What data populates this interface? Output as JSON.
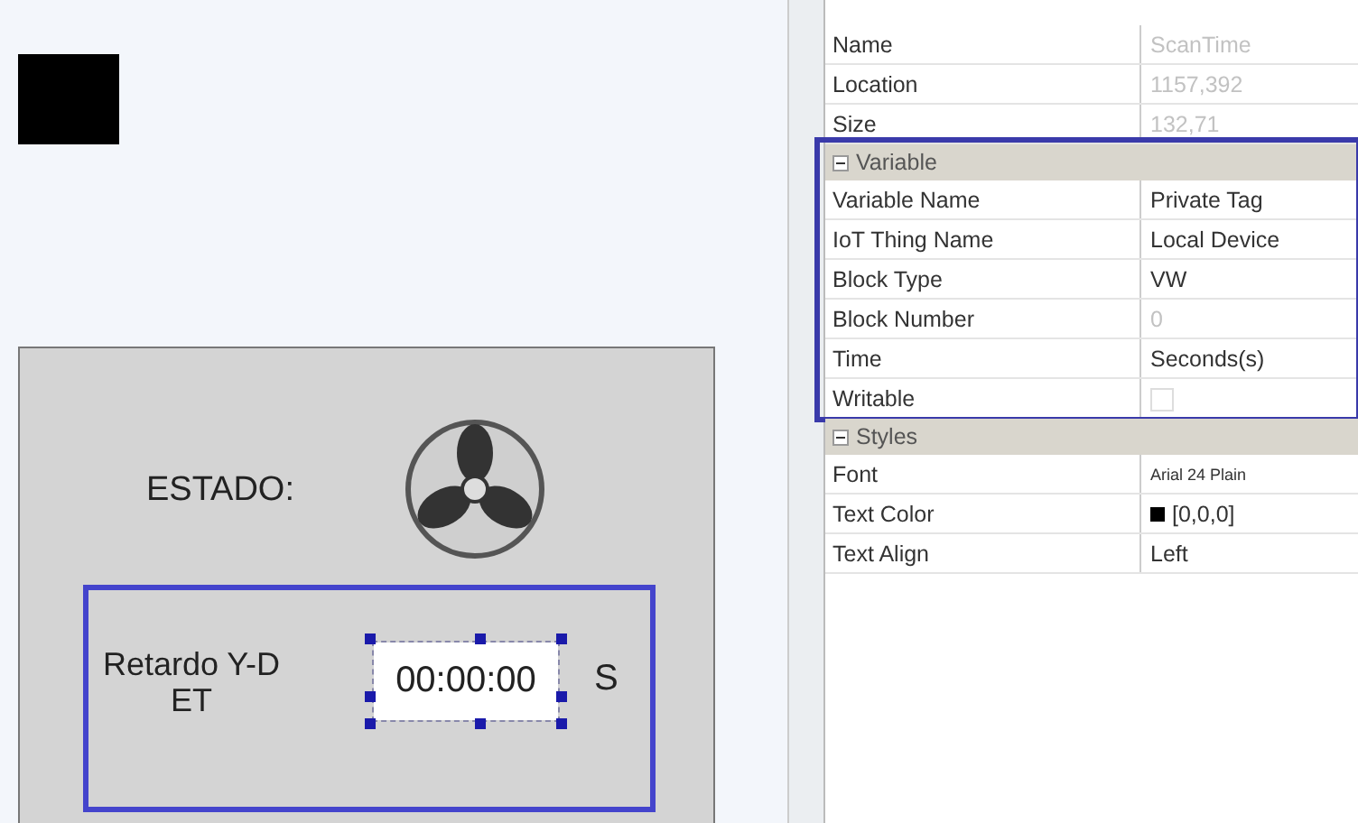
{
  "canvas": {
    "status_label": "ESTADO:",
    "delay_label": "Retardo Y-D ET",
    "time_field": {
      "value": "00:00:00",
      "selected": true
    },
    "unit": "S"
  },
  "properties": {
    "rows": [
      {
        "kind": "text",
        "label": "Name",
        "value": "ScanTime",
        "disabled": true
      },
      {
        "kind": "text",
        "label": "Location",
        "value": "1157,392",
        "disabled": true
      },
      {
        "kind": "text",
        "label": "Size",
        "value": "132,71",
        "disabled": true
      }
    ],
    "groups": [
      {
        "title": "Variable",
        "expanded": true,
        "selected": true,
        "rows": [
          {
            "kind": "text",
            "label": "Variable Name",
            "value": "Private Tag",
            "disabled": false,
            "small": false
          },
          {
            "kind": "text",
            "label": "IoT Thing Name",
            "value": "Local Device",
            "disabled": false,
            "small": false
          },
          {
            "kind": "text",
            "label": "Block Type",
            "value": "VW",
            "disabled": false,
            "small": false
          },
          {
            "kind": "text",
            "label": "Block Number",
            "value": "0",
            "disabled": true,
            "small": false
          },
          {
            "kind": "text",
            "label": "Time",
            "value": "Seconds(s)",
            "disabled": false,
            "small": false
          },
          {
            "kind": "checkbox",
            "label": "Writable",
            "checked": false,
            "disabled": true
          }
        ]
      },
      {
        "title": "Styles",
        "expanded": true,
        "selected": false,
        "rows": [
          {
            "kind": "text",
            "label": "Font",
            "value": "Arial 24 Plain",
            "disabled": false,
            "small": true
          },
          {
            "kind": "color",
            "label": "Text Color",
            "value": "[0,0,0]",
            "color": "#000000",
            "disabled": false
          },
          {
            "kind": "text",
            "label": "Text Align",
            "value": "Left",
            "disabled": false,
            "small": false
          }
        ]
      }
    ]
  }
}
